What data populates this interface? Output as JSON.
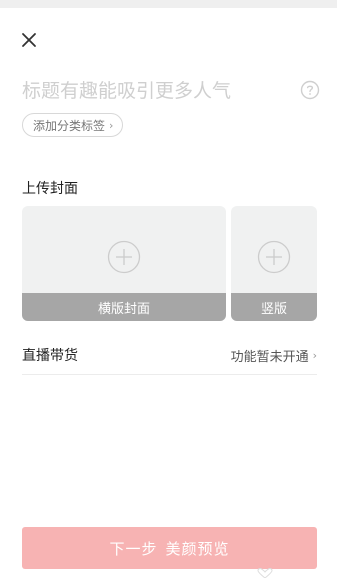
{
  "header": {
    "close_icon": "close-icon"
  },
  "title": {
    "placeholder": "标题有趣能吸引更多人气",
    "help_icon": "question-circle-icon"
  },
  "tag": {
    "label": "添加分类标签",
    "chevron": "›"
  },
  "cover": {
    "section_label": "上传封面",
    "landscape_label": "横版封面",
    "portrait_label": "竖版",
    "add_icon": "plus-circle-icon"
  },
  "live_shopping": {
    "label": "直播带货",
    "status": "功能暂未开通",
    "chevron": "›"
  },
  "footer": {
    "next_label": "下一步",
    "beauty_label": "美颜预览"
  },
  "colors": {
    "next_button_bg": "#f7b3b3",
    "cover_bg": "#f0f1f1",
    "cover_caption_bg": "#a6a6a6",
    "placeholder_text": "#cfcfcf"
  }
}
